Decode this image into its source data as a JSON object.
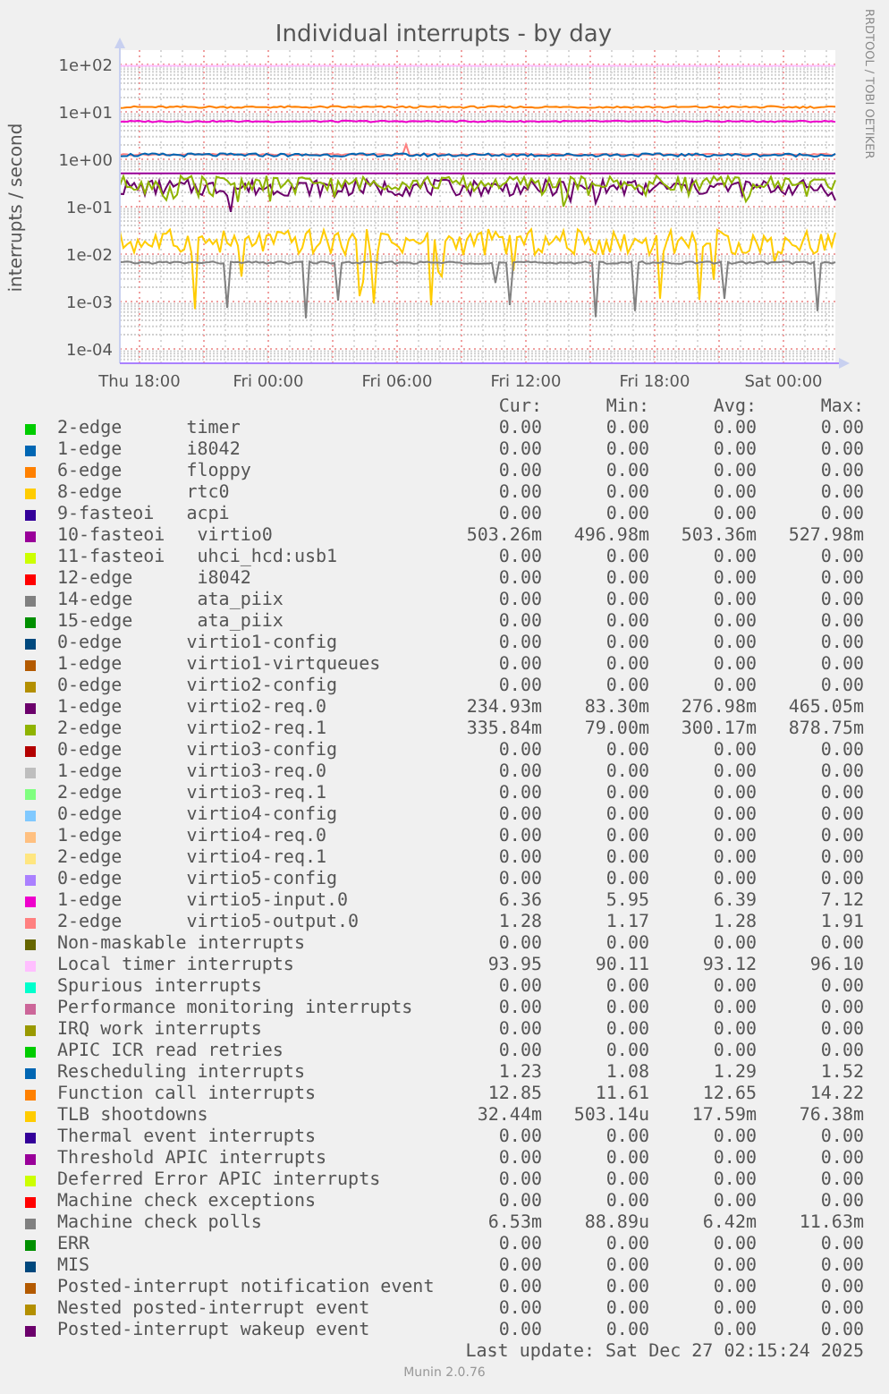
{
  "graph": {
    "title": "Individual interrupts - by day",
    "y_axis_label": "interrupts / second",
    "credit": "RRDTOOL / TOBI OETIKER",
    "y_ticks": [
      "1e+02",
      "1e+01",
      "1e+00",
      "1e-01",
      "1e-02",
      "1e-03",
      "1e-04"
    ],
    "x_ticks": [
      "Thu 18:00",
      "Fri 00:00",
      "Fri 06:00",
      "Fri 12:00",
      "Fri 18:00",
      "Sat 00:00"
    ]
  },
  "legend": {
    "columns": [
      "Cur:",
      "Min:",
      "Avg:",
      "Max:"
    ],
    "rows": [
      {
        "color": "#00cc00",
        "label": "2-edge      timer",
        "cur": "0.00",
        "min": "0.00",
        "avg": "0.00",
        "max": "0.00"
      },
      {
        "color": "#0066b3",
        "label": "1-edge      i8042",
        "cur": "0.00",
        "min": "0.00",
        "avg": "0.00",
        "max": "0.00"
      },
      {
        "color": "#ff8000",
        "label": "6-edge      floppy",
        "cur": "0.00",
        "min": "0.00",
        "avg": "0.00",
        "max": "0.00"
      },
      {
        "color": "#ffcc00",
        "label": "8-edge      rtc0",
        "cur": "0.00",
        "min": "0.00",
        "avg": "0.00",
        "max": "0.00"
      },
      {
        "color": "#330099",
        "label": "9-fasteoi   acpi",
        "cur": "0.00",
        "min": "0.00",
        "avg": "0.00",
        "max": "0.00"
      },
      {
        "color": "#990099",
        "label": "10-fasteoi   virtio0",
        "cur": "503.26m",
        "min": "496.98m",
        "avg": "503.36m",
        "max": "527.98m"
      },
      {
        "color": "#ccff00",
        "label": "11-fasteoi   uhci_hcd:usb1",
        "cur": "0.00",
        "min": "0.00",
        "avg": "0.00",
        "max": "0.00"
      },
      {
        "color": "#ff0000",
        "label": "12-edge      i8042",
        "cur": "0.00",
        "min": "0.00",
        "avg": "0.00",
        "max": "0.00"
      },
      {
        "color": "#808080",
        "label": "14-edge      ata_piix",
        "cur": "0.00",
        "min": "0.00",
        "avg": "0.00",
        "max": "0.00"
      },
      {
        "color": "#008f00",
        "label": "15-edge      ata_piix",
        "cur": "0.00",
        "min": "0.00",
        "avg": "0.00",
        "max": "0.00"
      },
      {
        "color": "#00487d",
        "label": "0-edge      virtio1-config",
        "cur": "0.00",
        "min": "0.00",
        "avg": "0.00",
        "max": "0.00"
      },
      {
        "color": "#b35a00",
        "label": "1-edge      virtio1-virtqueues",
        "cur": "0.00",
        "min": "0.00",
        "avg": "0.00",
        "max": "0.00"
      },
      {
        "color": "#b38f00",
        "label": "0-edge      virtio2-config",
        "cur": "0.00",
        "min": "0.00",
        "avg": "0.00",
        "max": "0.00"
      },
      {
        "color": "#6b006b",
        "label": "1-edge      virtio2-req.0",
        "cur": "234.93m",
        "min": "83.30m",
        "avg": "276.98m",
        "max": "465.05m"
      },
      {
        "color": "#8fb300",
        "label": "2-edge      virtio2-req.1",
        "cur": "335.84m",
        "min": "79.00m",
        "avg": "300.17m",
        "max": "878.75m"
      },
      {
        "color": "#b30000",
        "label": "0-edge      virtio3-config",
        "cur": "0.00",
        "min": "0.00",
        "avg": "0.00",
        "max": "0.00"
      },
      {
        "color": "#bebebe",
        "label": "1-edge      virtio3-req.0",
        "cur": "0.00",
        "min": "0.00",
        "avg": "0.00",
        "max": "0.00"
      },
      {
        "color": "#80ff80",
        "label": "2-edge      virtio3-req.1",
        "cur": "0.00",
        "min": "0.00",
        "avg": "0.00",
        "max": "0.00"
      },
      {
        "color": "#80c9ff",
        "label": "0-edge      virtio4-config",
        "cur": "0.00",
        "min": "0.00",
        "avg": "0.00",
        "max": "0.00"
      },
      {
        "color": "#ffc080",
        "label": "1-edge      virtio4-req.0",
        "cur": "0.00",
        "min": "0.00",
        "avg": "0.00",
        "max": "0.00"
      },
      {
        "color": "#ffe680",
        "label": "2-edge      virtio4-req.1",
        "cur": "0.00",
        "min": "0.00",
        "avg": "0.00",
        "max": "0.00"
      },
      {
        "color": "#aa80ff",
        "label": "0-edge      virtio5-config",
        "cur": "0.00",
        "min": "0.00",
        "avg": "0.00",
        "max": "0.00"
      },
      {
        "color": "#ee00cc",
        "label": "1-edge      virtio5-input.0",
        "cur": "6.36",
        "min": "5.95",
        "avg": "6.39",
        "max": "7.12"
      },
      {
        "color": "#ff8080",
        "label": "2-edge      virtio5-output.0",
        "cur": "1.28",
        "min": "1.17",
        "avg": "1.28",
        "max": "1.91"
      },
      {
        "color": "#666600",
        "label": "Non-maskable interrupts",
        "cur": "0.00",
        "min": "0.00",
        "avg": "0.00",
        "max": "0.00"
      },
      {
        "color": "#ffbfff",
        "label": "Local timer interrupts",
        "cur": "93.95",
        "min": "90.11",
        "avg": "93.12",
        "max": "96.10"
      },
      {
        "color": "#00ffcc",
        "label": "Spurious interrupts",
        "cur": "0.00",
        "min": "0.00",
        "avg": "0.00",
        "max": "0.00"
      },
      {
        "color": "#cc6699",
        "label": "Performance monitoring interrupts",
        "cur": "0.00",
        "min": "0.00",
        "avg": "0.00",
        "max": "0.00"
      },
      {
        "color": "#999900",
        "label": "IRQ work interrupts",
        "cur": "0.00",
        "min": "0.00",
        "avg": "0.00",
        "max": "0.00"
      },
      {
        "color": "#00cc00",
        "label": "APIC ICR read retries",
        "cur": "0.00",
        "min": "0.00",
        "avg": "0.00",
        "max": "0.00"
      },
      {
        "color": "#0066b3",
        "label": "Rescheduling interrupts",
        "cur": "1.23",
        "min": "1.08",
        "avg": "1.29",
        "max": "1.52"
      },
      {
        "color": "#ff8000",
        "label": "Function call interrupts",
        "cur": "12.85",
        "min": "11.61",
        "avg": "12.65",
        "max": "14.22"
      },
      {
        "color": "#ffcc00",
        "label": "TLB shootdowns",
        "cur": "32.44m",
        "min": "503.14u",
        "avg": "17.59m",
        "max": "76.38m"
      },
      {
        "color": "#330099",
        "label": "Thermal event interrupts",
        "cur": "0.00",
        "min": "0.00",
        "avg": "0.00",
        "max": "0.00"
      },
      {
        "color": "#990099",
        "label": "Threshold APIC interrupts",
        "cur": "0.00",
        "min": "0.00",
        "avg": "0.00",
        "max": "0.00"
      },
      {
        "color": "#ccff00",
        "label": "Deferred Error APIC interrupts",
        "cur": "0.00",
        "min": "0.00",
        "avg": "0.00",
        "max": "0.00"
      },
      {
        "color": "#ff0000",
        "label": "Machine check exceptions",
        "cur": "0.00",
        "min": "0.00",
        "avg": "0.00",
        "max": "0.00"
      },
      {
        "color": "#808080",
        "label": "Machine check polls",
        "cur": "6.53m",
        "min": "88.89u",
        "avg": "6.42m",
        "max": "11.63m"
      },
      {
        "color": "#008f00",
        "label": "ERR",
        "cur": "0.00",
        "min": "0.00",
        "avg": "0.00",
        "max": "0.00"
      },
      {
        "color": "#00487d",
        "label": "MIS",
        "cur": "0.00",
        "min": "0.00",
        "avg": "0.00",
        "max": "0.00"
      },
      {
        "color": "#b35a00",
        "label": "Posted-interrupt notification event",
        "cur": "0.00",
        "min": "0.00",
        "avg": "0.00",
        "max": "0.00"
      },
      {
        "color": "#b38f00",
        "label": "Nested posted-interrupt event",
        "cur": "0.00",
        "min": "0.00",
        "avg": "0.00",
        "max": "0.00"
      },
      {
        "color": "#6b006b",
        "label": "Posted-interrupt wakeup event",
        "cur": "0.00",
        "min": "0.00",
        "avg": "0.00",
        "max": "0.00"
      }
    ]
  },
  "last_update": "Last update: Sat Dec 27 02:15:24 2025",
  "version": "Munin 2.0.76"
}
